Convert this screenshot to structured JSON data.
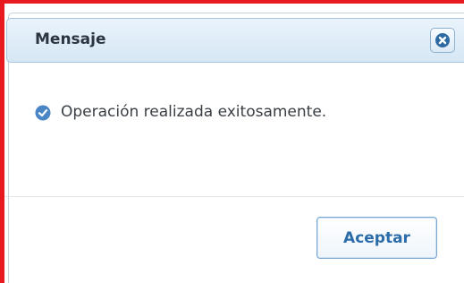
{
  "dialog": {
    "title": "Mensaje",
    "message": "Operación realizada exitosamente.",
    "accept_label": "Aceptar",
    "icons": {
      "close": "close-icon",
      "message": "check-circle-icon"
    }
  },
  "colors": {
    "frame_border": "#e8191f",
    "title_bar": "#dfedf8",
    "accent": "#2a6da9"
  }
}
